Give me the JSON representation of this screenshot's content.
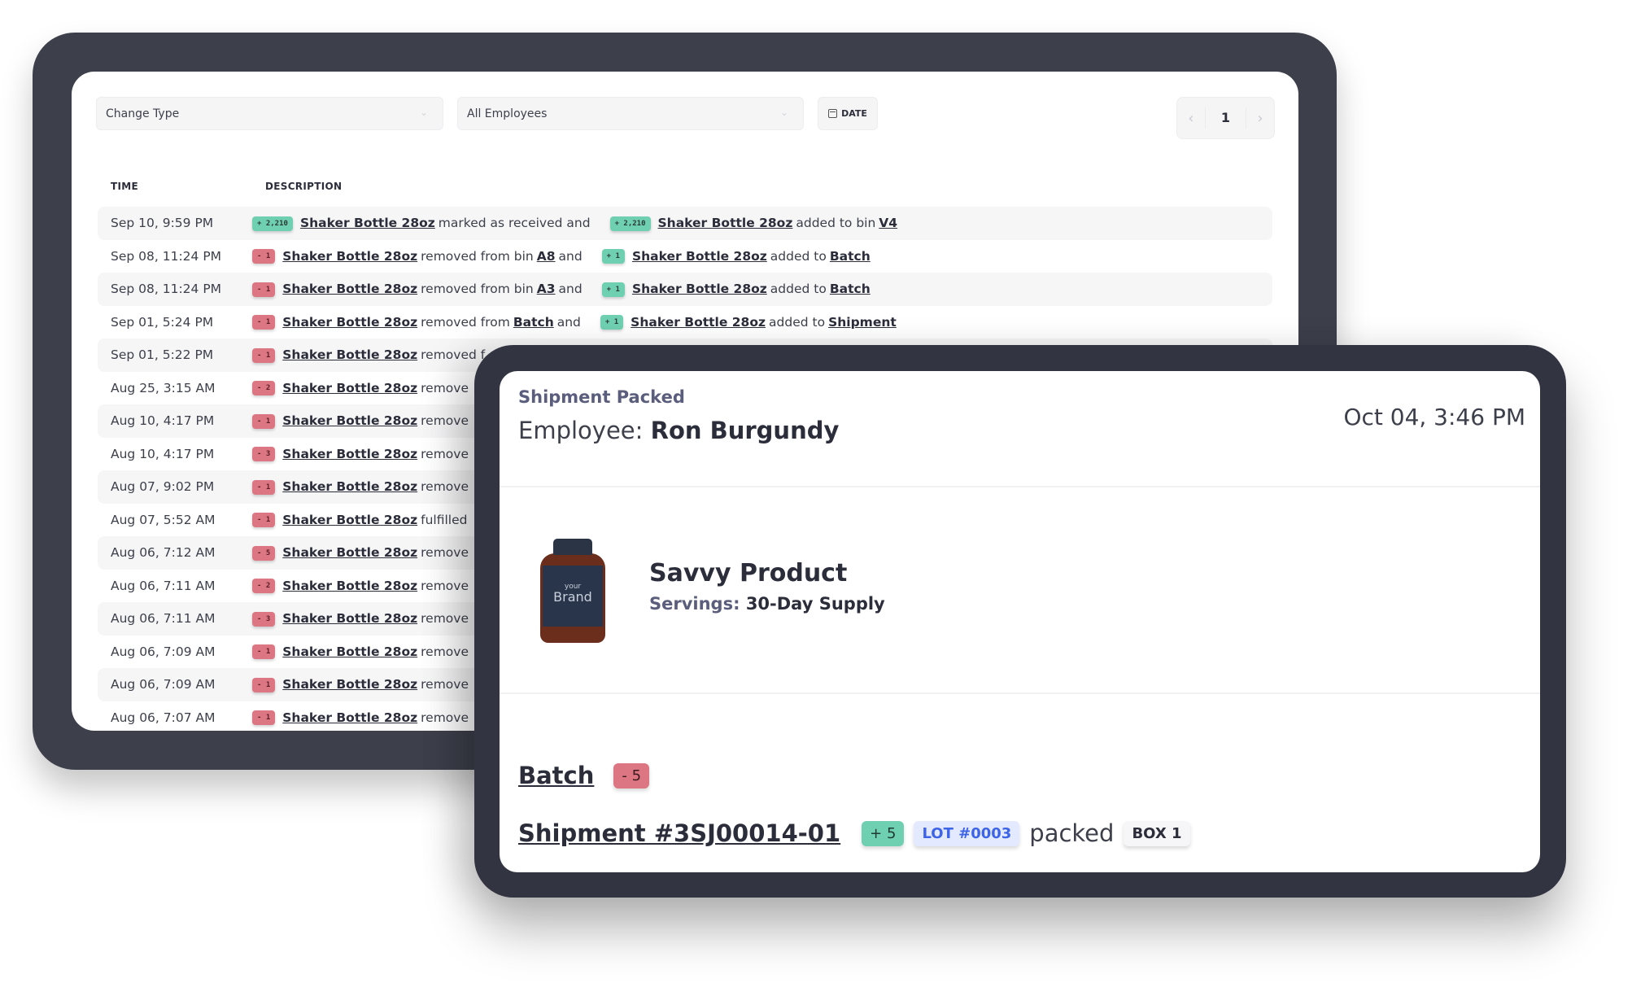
{
  "filters": {
    "change_type": "Change Type",
    "employees": "All Employees",
    "date_label": "DATE"
  },
  "pagination": {
    "prev": "‹",
    "page": "1",
    "next": "›"
  },
  "table": {
    "headers": {
      "time": "TIME",
      "description": "DESCRIPTION"
    },
    "rows": [
      {
        "time": "Sep 10, 9:59 PM",
        "parts": [
          {
            "t": "badge",
            "v": "+ 2,210",
            "k": "pos"
          },
          {
            "t": "link",
            "v": "Shaker Bottle 28oz"
          },
          {
            "t": "text",
            "v": "marked as received and"
          },
          {
            "t": "gap"
          },
          {
            "t": "badge",
            "v": "+ 2,210",
            "k": "pos"
          },
          {
            "t": "link",
            "v": "Shaker Bottle 28oz"
          },
          {
            "t": "text",
            "v": "added to bin"
          },
          {
            "t": "link",
            "v": "V4"
          }
        ]
      },
      {
        "time": "Sep 08, 11:24 PM",
        "parts": [
          {
            "t": "badge",
            "v": "- 1",
            "k": "neg"
          },
          {
            "t": "link",
            "v": "Shaker Bottle 28oz"
          },
          {
            "t": "text",
            "v": "removed from bin"
          },
          {
            "t": "link",
            "v": "A8"
          },
          {
            "t": "text",
            "v": "and"
          },
          {
            "t": "gap"
          },
          {
            "t": "badge",
            "v": "+ 1",
            "k": "pos"
          },
          {
            "t": "link",
            "v": "Shaker Bottle 28oz"
          },
          {
            "t": "text",
            "v": "added to"
          },
          {
            "t": "link",
            "v": "Batch"
          }
        ]
      },
      {
        "time": "Sep 08, 11:24 PM",
        "parts": [
          {
            "t": "badge",
            "v": "- 1",
            "k": "neg"
          },
          {
            "t": "link",
            "v": "Shaker Bottle 28oz"
          },
          {
            "t": "text",
            "v": "removed from bin"
          },
          {
            "t": "link",
            "v": "A3"
          },
          {
            "t": "text",
            "v": "and"
          },
          {
            "t": "gap"
          },
          {
            "t": "badge",
            "v": "+ 1",
            "k": "pos"
          },
          {
            "t": "link",
            "v": "Shaker Bottle 28oz"
          },
          {
            "t": "text",
            "v": "added to"
          },
          {
            "t": "link",
            "v": "Batch"
          }
        ]
      },
      {
        "time": "Sep 01, 5:24 PM",
        "parts": [
          {
            "t": "badge",
            "v": "- 1",
            "k": "neg"
          },
          {
            "t": "link",
            "v": "Shaker Bottle 28oz"
          },
          {
            "t": "text",
            "v": "removed from"
          },
          {
            "t": "link",
            "v": "Batch"
          },
          {
            "t": "text",
            "v": "and"
          },
          {
            "t": "gap"
          },
          {
            "t": "badge",
            "v": "+ 1",
            "k": "pos"
          },
          {
            "t": "link",
            "v": "Shaker Bottle 28oz"
          },
          {
            "t": "text",
            "v": "added to"
          },
          {
            "t": "link",
            "v": "Shipment"
          }
        ]
      },
      {
        "time": "Sep 01, 5:22 PM",
        "parts": [
          {
            "t": "badge",
            "v": "- 1",
            "k": "neg"
          },
          {
            "t": "link",
            "v": "Shaker Bottle 28oz"
          },
          {
            "t": "text",
            "v": "removed f"
          }
        ]
      },
      {
        "time": "Aug 25, 3:15 AM",
        "parts": [
          {
            "t": "badge",
            "v": "- 2",
            "k": "neg"
          },
          {
            "t": "link",
            "v": "Shaker Bottle 28oz"
          },
          {
            "t": "text",
            "v": "remove"
          }
        ]
      },
      {
        "time": "Aug 10, 4:17 PM",
        "parts": [
          {
            "t": "badge",
            "v": "- 1",
            "k": "neg"
          },
          {
            "t": "link",
            "v": "Shaker Bottle 28oz"
          },
          {
            "t": "text",
            "v": "remove"
          }
        ]
      },
      {
        "time": "Aug 10, 4:17 PM",
        "parts": [
          {
            "t": "badge",
            "v": "- 3",
            "k": "neg"
          },
          {
            "t": "link",
            "v": "Shaker Bottle 28oz"
          },
          {
            "t": "text",
            "v": "remove"
          }
        ]
      },
      {
        "time": "Aug 07, 9:02 PM",
        "parts": [
          {
            "t": "badge",
            "v": "- 1",
            "k": "neg"
          },
          {
            "t": "link",
            "v": "Shaker Bottle 28oz"
          },
          {
            "t": "text",
            "v": "remove"
          }
        ]
      },
      {
        "time": "Aug 07, 5:52 AM",
        "parts": [
          {
            "t": "badge",
            "v": "- 1",
            "k": "neg"
          },
          {
            "t": "link",
            "v": "Shaker Bottle 28oz"
          },
          {
            "t": "text",
            "v": "fulfilled"
          }
        ]
      },
      {
        "time": "Aug 06, 7:12 AM",
        "parts": [
          {
            "t": "badge",
            "v": "- 5",
            "k": "neg"
          },
          {
            "t": "link",
            "v": "Shaker Bottle 28oz"
          },
          {
            "t": "text",
            "v": "remove"
          }
        ]
      },
      {
        "time": "Aug 06, 7:11 AM",
        "parts": [
          {
            "t": "badge",
            "v": "- 2",
            "k": "neg"
          },
          {
            "t": "link",
            "v": "Shaker Bottle 28oz"
          },
          {
            "t": "text",
            "v": "remove"
          }
        ]
      },
      {
        "time": "Aug 06, 7:11 AM",
        "parts": [
          {
            "t": "badge",
            "v": "- 3",
            "k": "neg"
          },
          {
            "t": "link",
            "v": "Shaker Bottle 28oz"
          },
          {
            "t": "text",
            "v": "remove"
          }
        ]
      },
      {
        "time": "Aug 06, 7:09 AM",
        "parts": [
          {
            "t": "badge",
            "v": "- 1",
            "k": "neg"
          },
          {
            "t": "link",
            "v": "Shaker Bottle 28oz"
          },
          {
            "t": "text",
            "v": "remove"
          }
        ]
      },
      {
        "time": "Aug 06, 7:09 AM",
        "parts": [
          {
            "t": "badge",
            "v": "- 1",
            "k": "neg"
          },
          {
            "t": "link",
            "v": "Shaker Bottle 28oz"
          },
          {
            "t": "text",
            "v": "remove"
          }
        ]
      },
      {
        "time": "Aug 06, 7:07 AM",
        "parts": [
          {
            "t": "badge",
            "v": "- 1",
            "k": "neg"
          },
          {
            "t": "link",
            "v": "Shaker Bottle 28oz"
          },
          {
            "t": "text",
            "v": "remove"
          }
        ]
      }
    ]
  },
  "detail": {
    "event_type": "Shipment Packed",
    "employee_label": "Employee:",
    "employee_name": "Ron Burgundy",
    "timestamp": "Oct 04, 3:46 PM",
    "product": {
      "image_label_small": "your",
      "image_label_big": "Brand",
      "name": "Savvy Product",
      "servings_label": "Servings:",
      "servings_value": "30-Day Supply"
    },
    "batch": {
      "label": "Batch",
      "delta": "- 5"
    },
    "shipment": {
      "label": "Shipment #3SJ00014-01",
      "delta": "+ 5",
      "lot": "LOT #0003",
      "action": "packed",
      "box": "BOX 1"
    }
  },
  "colors": {
    "frame_back": "#3d404b",
    "frame_front": "#323441",
    "positive": "#6fd0b1",
    "negative": "#dc7683",
    "lot_bg": "#e3e9ff",
    "lot_text": "#3d63e6"
  }
}
